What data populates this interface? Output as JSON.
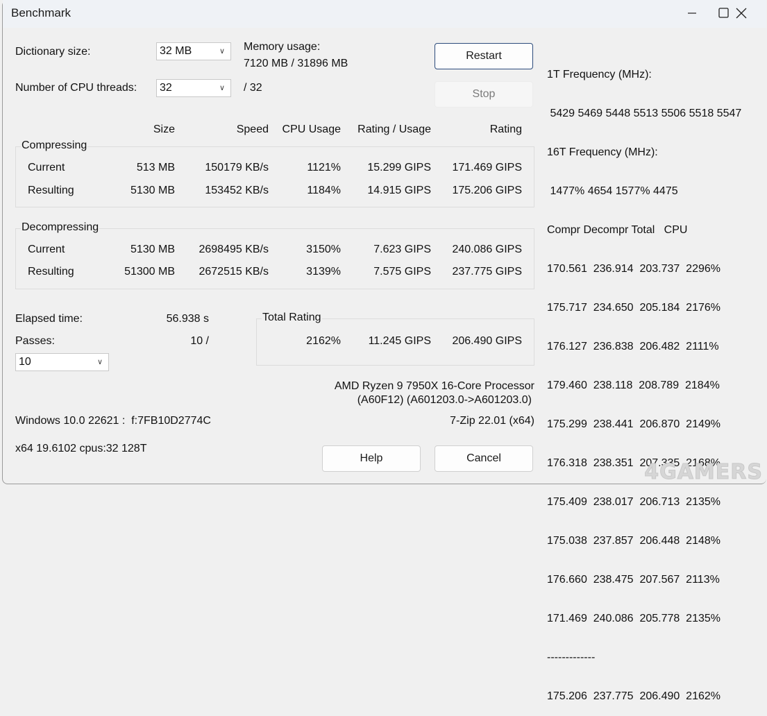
{
  "window": {
    "title": "Benchmark",
    "controls": {
      "minimize": "minimize-icon",
      "maximize": "maximize-icon",
      "close": "close-icon"
    }
  },
  "settings": {
    "dictionary_label": "Dictionary size:",
    "dictionary_value": "32 MB",
    "threads_label": "Number of CPU threads:",
    "threads_value": "32",
    "threads_max": "/ 32",
    "memory_label": "Memory usage:",
    "memory_value": "7120 MB / 31896 MB"
  },
  "buttons": {
    "restart": "Restart",
    "stop": "Stop",
    "help": "Help",
    "cancel": "Cancel"
  },
  "table": {
    "headers": [
      "Size",
      "Speed",
      "CPU Usage",
      "Rating / Usage",
      "Rating"
    ],
    "compressing": {
      "title": "Compressing",
      "rows": [
        {
          "label": "Current",
          "size": "513 MB",
          "speed": "150179 KB/s",
          "cpu": "1121%",
          "rpu": "15.299 GIPS",
          "rating": "171.469 GIPS"
        },
        {
          "label": "Resulting",
          "size": "5130 MB",
          "speed": "153452 KB/s",
          "cpu": "1184%",
          "rpu": "14.915 GIPS",
          "rating": "175.206 GIPS"
        }
      ]
    },
    "decompressing": {
      "title": "Decompressing",
      "rows": [
        {
          "label": "Current",
          "size": "5130 MB",
          "speed": "2698495 KB/s",
          "cpu": "3150%",
          "rpu": "7.623 GIPS",
          "rating": "240.086 GIPS"
        },
        {
          "label": "Resulting",
          "size": "51300 MB",
          "speed": "2672515 KB/s",
          "cpu": "3139%",
          "rpu": "7.575 GIPS",
          "rating": "237.775 GIPS"
        }
      ]
    }
  },
  "stats": {
    "elapsed_label": "Elapsed time:",
    "elapsed_value": "56.938 s",
    "passes_label": "Passes:",
    "passes_value": "10 /",
    "passes_select": "10"
  },
  "total_rating": {
    "title": "Total Rating",
    "cpu": "2162%",
    "rpu": "11.245 GIPS",
    "rating": "206.490 GIPS"
  },
  "system": {
    "cpu_name": "AMD Ryzen 9 7950X 16-Core Processor",
    "cpu_id": "(A60F12) (A601203.0->A601203.0)",
    "version": "7-Zip 22.01 (x64)",
    "os": "Windows 10.0 22621 :  f:7FB10D2774C",
    "arch": "x64 19.6102 cpus:32 128T"
  },
  "log": {
    "freq1_label": "1T Frequency (MHz):",
    "freq1_values": " 5429 5469 5448 5513 5506 5518 5547",
    "freq16_label": "16T Frequency (MHz):",
    "freq16_values": " 1477% 4654 1577% 4475",
    "columns_header": "Compr Decompr Total   CPU",
    "rows": [
      "170.561  236.914  203.737  2296%",
      "175.717  234.650  205.184  2176%",
      "176.127  236.838  206.482  2111%",
      "179.460  238.118  208.789  2184%",
      "175.299  238.441  206.870  2149%",
      "176.318  238.351  207.335  2168%",
      "175.409  238.017  206.713  2135%",
      "175.038  237.857  206.448  2148%",
      "176.660  238.475  207.567  2113%",
      "171.469  240.086  205.778  2135%"
    ],
    "separator": "-------------",
    "summary": "175.206  237.775  206.490  2162%"
  },
  "watermark": "4GAMERS"
}
